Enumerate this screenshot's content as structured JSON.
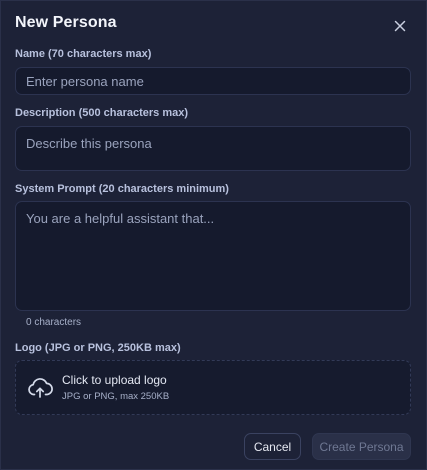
{
  "dialog": {
    "title": "New Persona",
    "close_icon": "close-icon"
  },
  "name_field": {
    "label": "Name (70 characters max)",
    "placeholder": "Enter persona name",
    "value": ""
  },
  "description_field": {
    "label": "Description (500 characters max)",
    "placeholder": "Describe this persona",
    "value": ""
  },
  "system_prompt_field": {
    "label": "System Prompt (20 characters minimum)",
    "placeholder": "You are a helpful assistant that...",
    "value": "",
    "char_count": "0 characters"
  },
  "logo_field": {
    "label": "Logo (JPG or PNG, 250KB max)",
    "upload_icon": "cloud-upload-icon",
    "upload_title": "Click to upload logo",
    "upload_hint": "JPG or PNG, max 250KB"
  },
  "actions": {
    "cancel_label": "Cancel",
    "create_label": "Create Persona"
  },
  "colors": {
    "background": "#1d2237",
    "field_background": "#151a2d",
    "field_border": "#2c3350",
    "label_text": "#b8c1dd",
    "disabled_button_text": "#6f7893"
  }
}
